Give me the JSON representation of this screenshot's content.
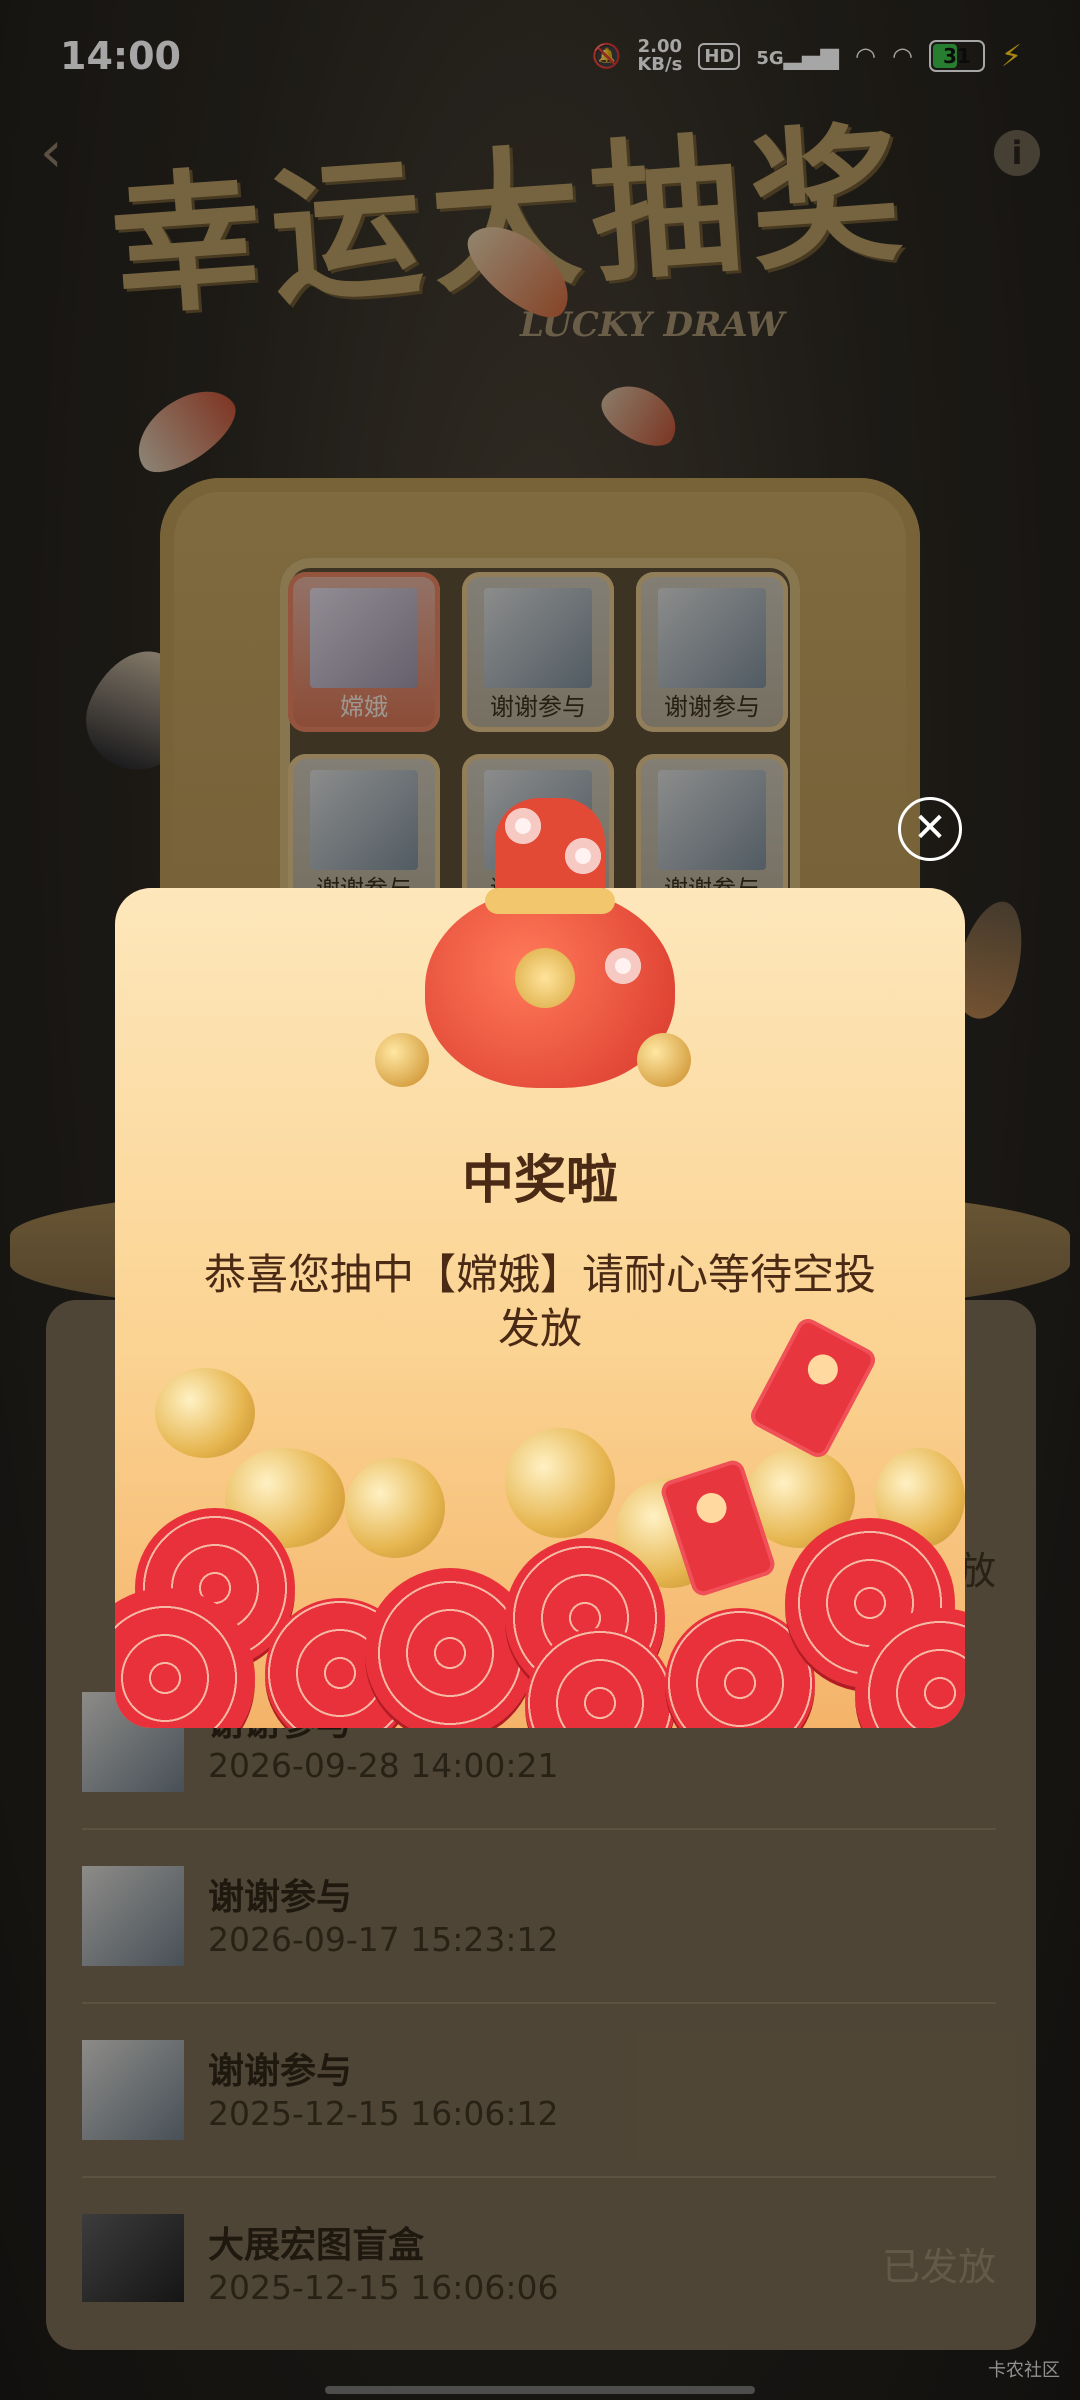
{
  "status_bar": {
    "time": "14:00",
    "speed_value": "2.00",
    "speed_unit": "KB/s",
    "hd": "HD",
    "network": "5G",
    "battery": "31",
    "icons": [
      "mute-icon",
      "signal-icon",
      "wifi-icon",
      "battery-icon",
      "charging-icon"
    ]
  },
  "header": {
    "title_art": "幸运大抽奖",
    "subtitle_art": "LUCKY DRAW"
  },
  "prize_grid": [
    {
      "label": "嫦娥",
      "active": true
    },
    {
      "label": "谢谢参与",
      "active": false
    },
    {
      "label": "谢谢参与",
      "active": false
    },
    {
      "label": "谢谢参与",
      "active": false
    },
    {
      "label": "谢谢参与",
      "active": false
    },
    {
      "label": "谢谢参与",
      "active": false
    }
  ],
  "records": {
    "partial_status": "放",
    "items": [
      {
        "name": "谢谢参与",
        "time": "2026-09-28 14:00:21",
        "status": ""
      },
      {
        "name": "谢谢参与",
        "time": "2026-09-17 15:23:12",
        "status": ""
      },
      {
        "name": "谢谢参与",
        "time": "2025-12-15 16:06:12",
        "status": ""
      },
      {
        "name": "大展宏图盲盒",
        "time": "2025-12-15 16:06:06",
        "status": "已发放"
      }
    ]
  },
  "dialog": {
    "title": "中奖啦",
    "message": "恭喜您抽中【嫦娥】请耐心等待空投发放",
    "close_symbol": "✕"
  },
  "watermark": "卡农社区",
  "colors": {
    "accent_gold": "#c5a361",
    "dialog_top": "#fde7bb",
    "dialog_bottom": "#f4b369",
    "red": "#e8313a",
    "text_dark": "#4a2a14"
  }
}
